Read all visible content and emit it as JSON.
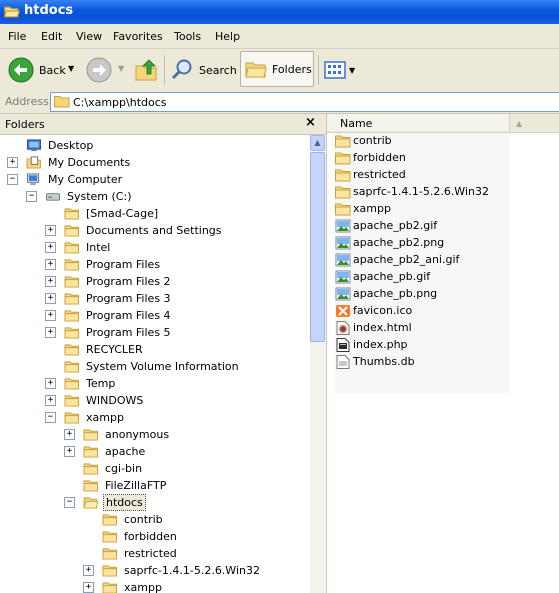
{
  "window": {
    "title": "htdocs"
  },
  "menu": [
    "File",
    "Edit",
    "View",
    "Favorites",
    "Tools",
    "Help"
  ],
  "toolbar": {
    "back": "Back",
    "search": "Search",
    "folders": "Folders"
  },
  "address": {
    "label": "Address",
    "path": "C:\\xampp\\htdocs"
  },
  "folders_pane": {
    "title": "Folders",
    "close": "×",
    "tree": [
      {
        "label": "Desktop",
        "icon": "desktop-icon",
        "expander": "none",
        "level": 0
      },
      {
        "label": "My Documents",
        "icon": "my-documents-icon",
        "expander": "plus",
        "level": 0
      },
      {
        "label": "My Computer",
        "icon": "my-computer-icon",
        "expander": "minus",
        "level": 0
      },
      {
        "label": "System (C:)",
        "icon": "drive-icon",
        "expander": "minus",
        "level": 1
      },
      {
        "label": "[Smad-Cage]",
        "icon": "folder-icon",
        "expander": "none",
        "level": 2
      },
      {
        "label": "Documents and Settings",
        "icon": "folder-icon",
        "expander": "plus",
        "level": 2
      },
      {
        "label": "Intel",
        "icon": "folder-icon",
        "expander": "plus",
        "level": 2
      },
      {
        "label": "Program Files",
        "icon": "folder-icon",
        "expander": "plus",
        "level": 2
      },
      {
        "label": "Program Files 2",
        "icon": "folder-icon",
        "expander": "plus",
        "level": 2
      },
      {
        "label": "Program Files 3",
        "icon": "folder-icon",
        "expander": "plus",
        "level": 2
      },
      {
        "label": "Program Files 4",
        "icon": "folder-icon",
        "expander": "plus",
        "level": 2
      },
      {
        "label": "Program Files 5",
        "icon": "folder-icon",
        "expander": "plus",
        "level": 2
      },
      {
        "label": "RECYCLER",
        "icon": "folder-icon",
        "expander": "none",
        "level": 2
      },
      {
        "label": "System Volume Information",
        "icon": "folder-icon",
        "expander": "none",
        "level": 2
      },
      {
        "label": "Temp",
        "icon": "folder-icon",
        "expander": "plus",
        "level": 2
      },
      {
        "label": "WINDOWS",
        "icon": "folder-icon",
        "expander": "plus",
        "level": 2
      },
      {
        "label": "xampp",
        "icon": "folder-icon",
        "expander": "minus",
        "level": 2
      },
      {
        "label": "anonymous",
        "icon": "folder-icon",
        "expander": "plus",
        "level": 3
      },
      {
        "label": "apache",
        "icon": "folder-icon",
        "expander": "plus",
        "level": 3
      },
      {
        "label": "cgi-bin",
        "icon": "folder-icon",
        "expander": "none",
        "level": 3
      },
      {
        "label": "FileZillaFTP",
        "icon": "folder-icon",
        "expander": "none",
        "level": 3
      },
      {
        "label": "htdocs",
        "icon": "folder-open-icon",
        "expander": "minus",
        "level": 3,
        "selected": true
      },
      {
        "label": "contrib",
        "icon": "folder-icon",
        "expander": "none",
        "level": 4
      },
      {
        "label": "forbidden",
        "icon": "folder-icon",
        "expander": "none",
        "level": 4
      },
      {
        "label": "restricted",
        "icon": "folder-icon",
        "expander": "none",
        "level": 4
      },
      {
        "label": "saprfc-1.4.1-5.2.6.Win32",
        "icon": "folder-icon",
        "expander": "plus",
        "level": 4
      },
      {
        "label": "xampp",
        "icon": "folder-icon",
        "expander": "plus",
        "level": 4
      }
    ]
  },
  "file_list": {
    "column_name": "Name",
    "files": [
      {
        "name": "contrib",
        "icon": "folder-icon"
      },
      {
        "name": "forbidden",
        "icon": "folder-icon"
      },
      {
        "name": "restricted",
        "icon": "folder-icon"
      },
      {
        "name": "saprfc-1.4.1-5.2.6.Win32",
        "icon": "folder-icon"
      },
      {
        "name": "xampp",
        "icon": "folder-icon"
      },
      {
        "name": "apache_pb2.gif",
        "icon": "image-icon"
      },
      {
        "name": "apache_pb2.png",
        "icon": "image-icon"
      },
      {
        "name": "apache_pb2_ani.gif",
        "icon": "image-icon"
      },
      {
        "name": "apache_pb.gif",
        "icon": "image-icon"
      },
      {
        "name": "apache_pb.png",
        "icon": "image-icon"
      },
      {
        "name": "favicon.ico",
        "icon": "xampp-ico-icon"
      },
      {
        "name": "index.html",
        "icon": "html-file-icon"
      },
      {
        "name": "index.php",
        "icon": "php-file-icon"
      },
      {
        "name": "Thumbs.db",
        "icon": "db-file-icon"
      }
    ]
  },
  "colors": {
    "titlebar": "#0a5be0",
    "chrome": "#ece9d8",
    "folder_fill": "#f6d67a",
    "folder_edge": "#c9a33a"
  }
}
